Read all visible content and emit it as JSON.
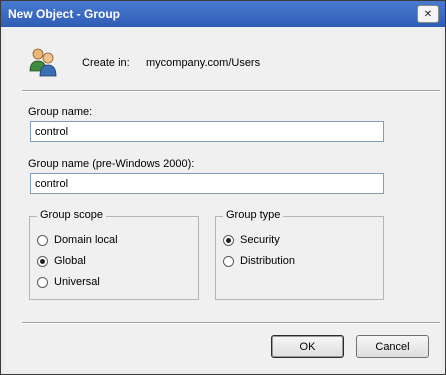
{
  "window": {
    "title": "New Object - Group",
    "close_glyph": "✕"
  },
  "header": {
    "create_in_label": "Create in:",
    "create_in_value": "mycompany.com/Users",
    "icon": "group-users-icon"
  },
  "fields": {
    "group_name_label": "Group name:",
    "group_name_value": "control",
    "group_name_pre2000_label": "Group name (pre-Windows 2000):",
    "group_name_pre2000_value": "control"
  },
  "group_scope": {
    "legend": "Group scope",
    "options": [
      {
        "label": "Domain local",
        "selected": false
      },
      {
        "label": "Global",
        "selected": true
      },
      {
        "label": "Universal",
        "selected": false
      }
    ]
  },
  "group_type": {
    "legend": "Group type",
    "options": [
      {
        "label": "Security",
        "selected": true
      },
      {
        "label": "Distribution",
        "selected": false
      }
    ]
  },
  "buttons": {
    "ok": "OK",
    "cancel": "Cancel"
  },
  "colors": {
    "titlebar": "#3b6bc5",
    "dialog_bg": "#f0f0f0",
    "input_border": "#7f9db9"
  }
}
